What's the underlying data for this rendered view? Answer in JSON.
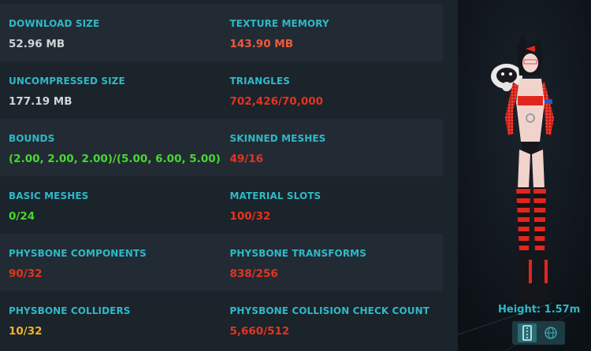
{
  "stats": {
    "download_size": {
      "label": "DOWNLOAD SIZE",
      "value": "52.96 MB"
    },
    "texture_memory": {
      "label": "TEXTURE MEMORY",
      "value": "143.90 MB"
    },
    "uncompressed_size": {
      "label": "UNCOMPRESSED SIZE",
      "value": "177.19 MB"
    },
    "triangles": {
      "label": "TRIANGLES",
      "value": "702,426/70,000"
    },
    "bounds": {
      "label": "BOUNDS",
      "value": "(2.00, 2.00, 2.00)/(5.00, 6.00, 5.00)"
    },
    "skinned_meshes": {
      "label": "SKINNED MESHES",
      "value": "49/16"
    },
    "basic_meshes": {
      "label": "BASIC MESHES",
      "value": "0/24"
    },
    "material_slots": {
      "label": "MATERIAL SLOTS",
      "value": "100/32"
    },
    "physbone_components": {
      "label": "PHYSBONE COMPONENTS",
      "value": "90/32"
    },
    "physbone_transforms": {
      "label": "PHYSBONE TRANSFORMS",
      "value": "838/256"
    },
    "physbone_colliders": {
      "label": "PHYSBONE COLLIDERS",
      "value": "10/32"
    },
    "physbone_collision_check_count": {
      "label": "PHYSBONE COLLISION CHECK COUNT",
      "value": "5,660/512"
    }
  },
  "preview": {
    "height_label": "Height: 1.57m",
    "buttons": [
      "zipper-icon",
      "globe-icon"
    ]
  },
  "colors": {
    "label": "#2fb8c6",
    "ok": "#47d92c",
    "warn": "#f0b22a",
    "bad": "#e4341f",
    "neutral": "#cfd4d8"
  }
}
